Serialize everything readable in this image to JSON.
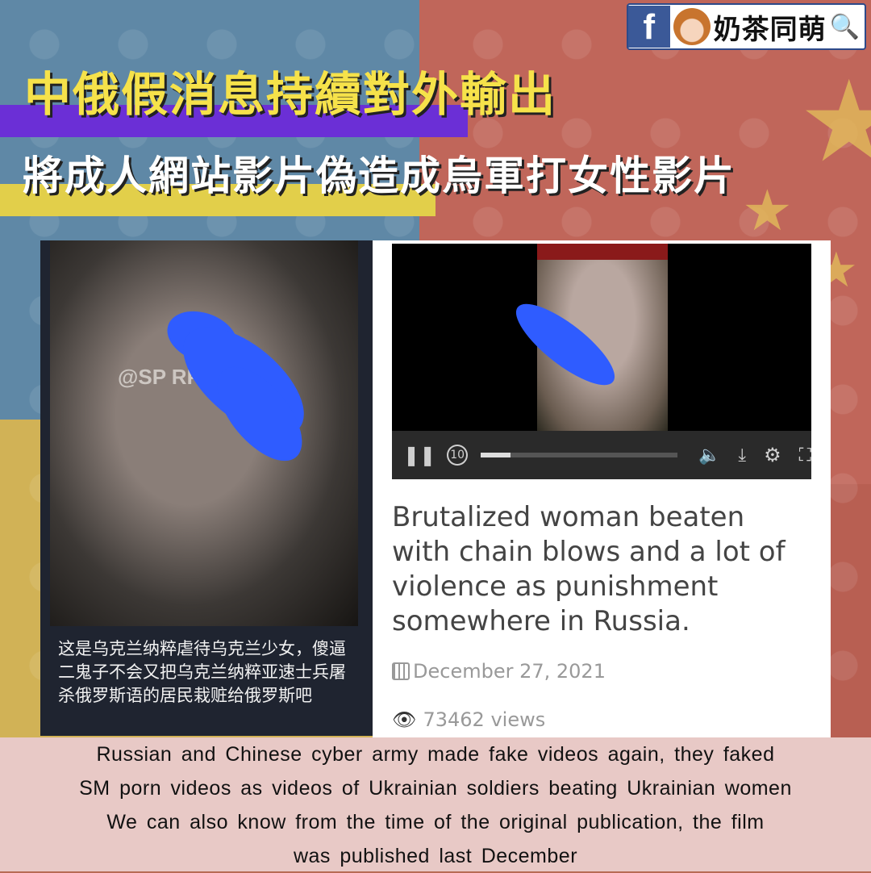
{
  "brand": {
    "text": "奶茶同萌",
    "fb_letter": "f",
    "search_icon": "magnifier-icon"
  },
  "headline": {
    "line1": "中俄假消息持續對外輸出",
    "line2": "將成人網站影片偽造成烏軍打女性影片"
  },
  "left_post": {
    "watermark": "@SP        RPLUS",
    "caption": "这是乌克兰纳粹虐待乌克兰少女，傻逼二鬼子不会又把乌克兰纳粹亚速士兵屠杀俄罗斯语的居民栽赃给俄罗斯吧"
  },
  "right_post": {
    "title": "Brutalized woman beaten with chain blows and a lot of violence as punishment somewhere in Russia.",
    "date": "December 27, 2021",
    "views": "73462 views",
    "player": {
      "progress": 0.15,
      "replay_label": "10"
    }
  },
  "footer": {
    "line1": "Russian and Chinese cyber army made fake videos again, they faked",
    "line2": "SM porn videos as videos of Ukrainian soldiers beating Ukrainian women",
    "line3": "We can also know from the time of the original publication, the film",
    "line4": "was published last December"
  },
  "colors": {
    "accent_yellow": "#f6e24a",
    "accent_purple": "#6b2fd6",
    "blur_blue": "#2f5cff"
  }
}
